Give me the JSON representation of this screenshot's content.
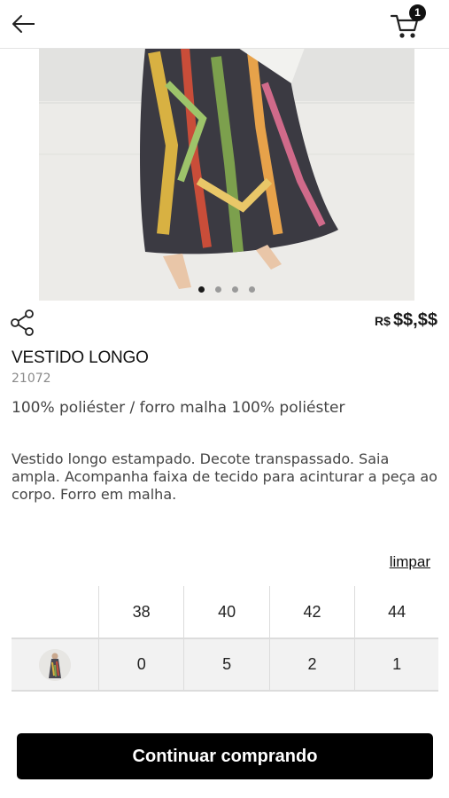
{
  "header": {
    "cart_count": "1"
  },
  "product": {
    "price_currency": "R$",
    "price_value": "$$,$$",
    "name": "VESTIDO LONGO",
    "reference": "21072",
    "composition": "100% poliéster / forro malha 100% poliéster",
    "description": "Vestido longo estampado. Decote transpassado. Saia ampla. Acompanha faixa de tecido para acinturar a peça ao corpo. Forro em malha.",
    "image_count": 4,
    "active_image_index": 0
  },
  "size_grid": {
    "clear_label": "limpar",
    "sizes": [
      "38",
      "40",
      "42",
      "44"
    ],
    "quantities": [
      "0",
      "5",
      "2",
      "1"
    ]
  },
  "cta": {
    "label": "Continuar comprando"
  },
  "colors": {
    "accent": "#000000",
    "text": "#1a1a1a",
    "muted": "#8a8a8a"
  }
}
